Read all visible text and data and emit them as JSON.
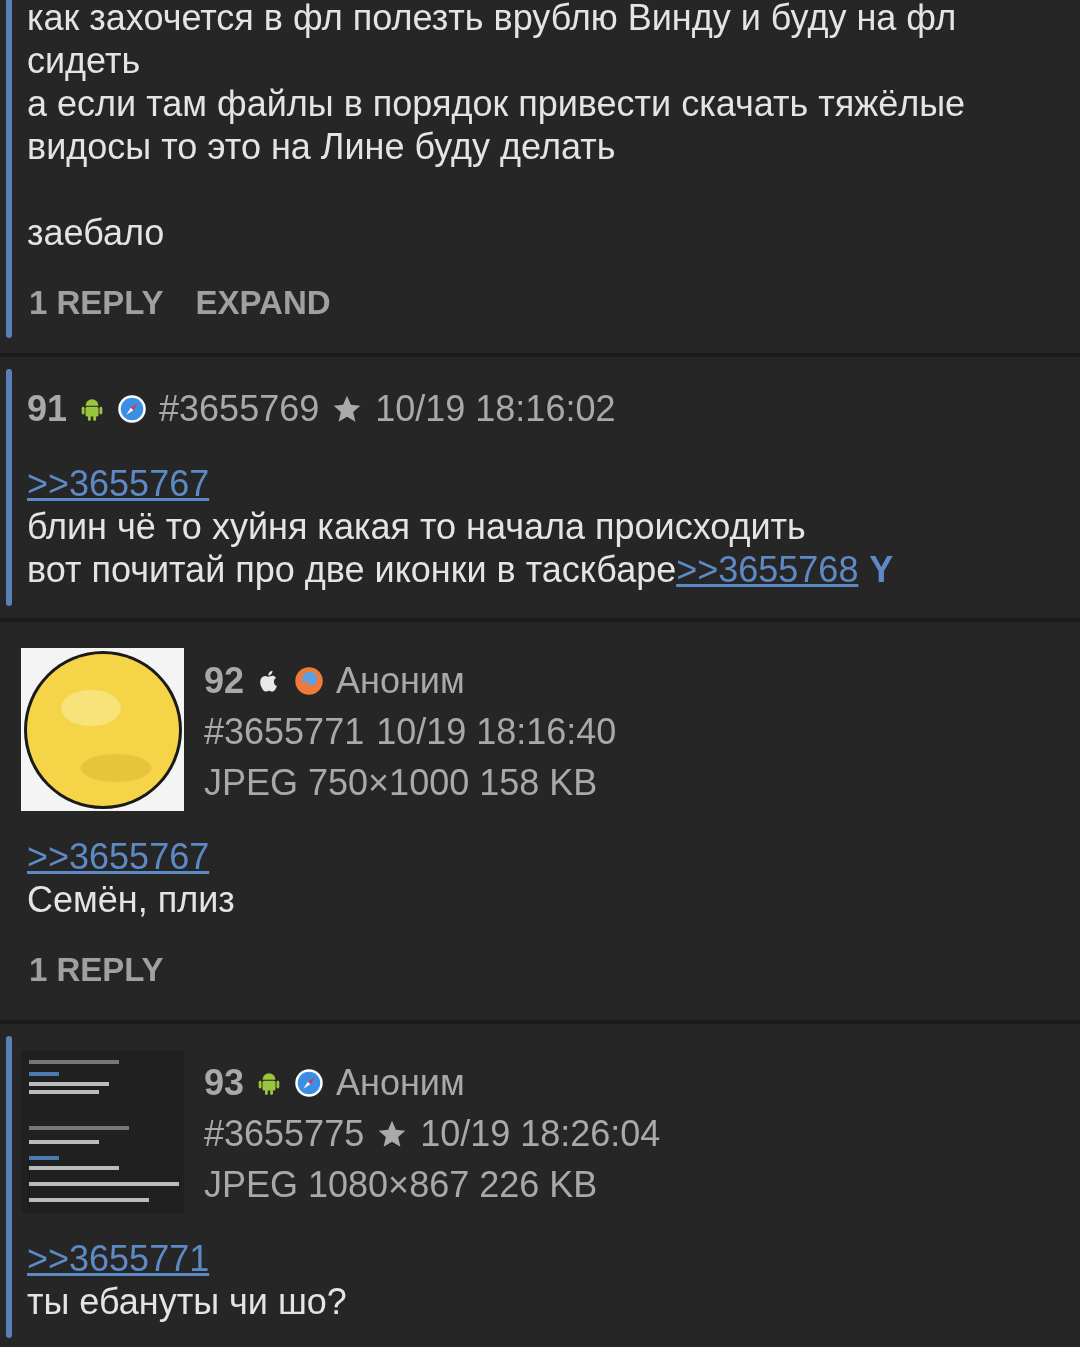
{
  "posts": [
    {
      "marked": true,
      "body": [
        {
          "kind": "text",
          "text": "как захочется в фл полезть врублю Винду и буду на фл сидеть\nа если там файлы в порядок привести скачать тяжёлые видосы то это на Лине буду делать\n\nзаебало"
        }
      ],
      "actions": [
        "1 REPLY",
        "EXPAND"
      ]
    },
    {
      "marked": true,
      "number": "91",
      "icons": [
        {
          "kind": "android"
        },
        {
          "kind": "safari"
        }
      ],
      "post_id": "#3655769",
      "starred": true,
      "date": "10/19 18:16:02",
      "body": [
        {
          "kind": "link",
          "text": ">>3655767"
        },
        {
          "kind": "text",
          "text": "\nблин чё то хуйня какая то начала происходить\nвот почитай про две иконки в таскбаре"
        },
        {
          "kind": "link",
          "text": ">>3655768"
        },
        {
          "kind": "you",
          "text": "Y"
        }
      ]
    },
    {
      "marked": false,
      "thumbnail": {
        "kind": "picture"
      },
      "number": "92",
      "icons": [
        {
          "kind": "apple"
        },
        {
          "kind": "firefox"
        }
      ],
      "name": "Аноним",
      "post_id": "#3655771",
      "starred": false,
      "date": "10/19 18:16:40",
      "file": "JPEG 750×1000 158 KB",
      "body": [
        {
          "kind": "link",
          "text": ">>3655767"
        },
        {
          "kind": "text",
          "text": "\nСемён, плиз"
        }
      ],
      "actions": [
        "1 REPLY"
      ]
    },
    {
      "marked": true,
      "thumbnail": {
        "kind": "picture"
      },
      "number": "93",
      "icons": [
        {
          "kind": "android"
        },
        {
          "kind": "safari"
        }
      ],
      "name": "Аноним",
      "post_id": "#3655775",
      "starred": true,
      "date": "10/19 18:26:04",
      "file": "JPEG 1080×867 226 KB",
      "body": [
        {
          "kind": "link",
          "text": ">>3655771"
        },
        {
          "kind": "text",
          "text": "\nты ебануты чи шо?"
        }
      ]
    }
  ]
}
